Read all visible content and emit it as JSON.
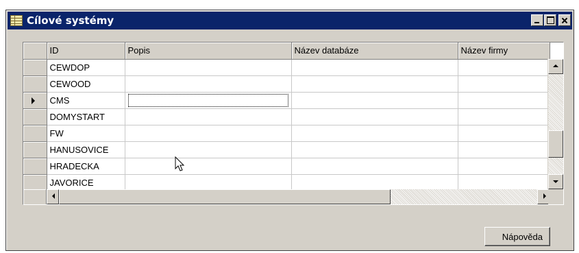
{
  "window": {
    "title": "Cílové systémy",
    "title_icon": "table-icon",
    "controls": [
      "minimize-icon",
      "maximize-icon",
      "close-icon"
    ],
    "title_color": "#0a246a"
  },
  "grid": {
    "columns": [
      "ID",
      "Popis",
      "Název databáze",
      "Název firmy"
    ],
    "rows": [
      {
        "id": "CEWDOP",
        "popis": "",
        "db": "",
        "firma": ""
      },
      {
        "id": "CEWOOD",
        "popis": "",
        "db": "",
        "firma": ""
      },
      {
        "id": "CMS",
        "popis": "",
        "db": "",
        "firma": ""
      },
      {
        "id": "DOMYSTART",
        "popis": "",
        "db": "",
        "firma": ""
      },
      {
        "id": "FW",
        "popis": "",
        "db": "",
        "firma": ""
      },
      {
        "id": "HANUSOVICE",
        "popis": "",
        "db": "",
        "firma": ""
      },
      {
        "id": "HRADECKA",
        "popis": "",
        "db": "",
        "firma": ""
      },
      {
        "id": "JAVORICE",
        "popis": "",
        "db": "",
        "firma": ""
      }
    ],
    "current_row_indicator": "row-pointer-icon",
    "focused_cell": "Popis"
  },
  "footer": {
    "help_label": "Nápověda"
  }
}
